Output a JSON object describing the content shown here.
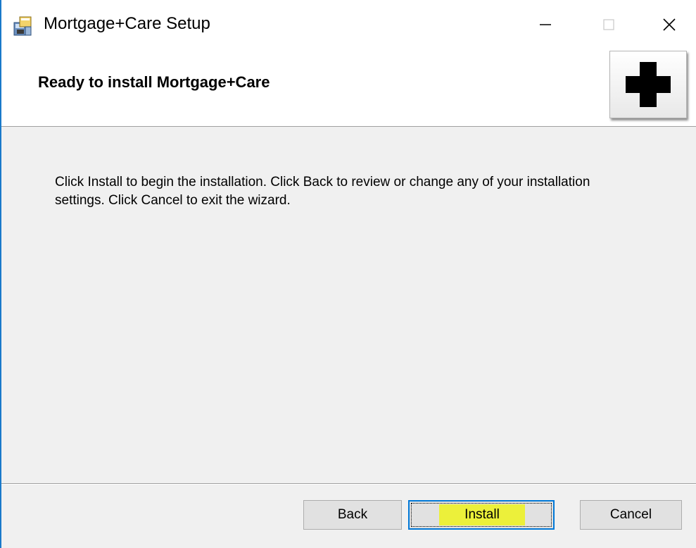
{
  "window": {
    "title": "Mortgage+Care Setup",
    "controls": {
      "minimize_icon": "minimize-icon",
      "maximize_icon": "maximize-icon",
      "close_icon": "close-icon"
    }
  },
  "header": {
    "title": "Ready to install Mortgage+Care",
    "icon": "plus-icon"
  },
  "body": {
    "message": "Click Install to begin the installation. Click Back to review or change any of your installation settings. Click Cancel to exit the wizard."
  },
  "footer": {
    "back_label": "Back",
    "install_label": "Install",
    "cancel_label": "Cancel"
  },
  "colors": {
    "accent": "#0078d7",
    "highlight": "#ecf03a",
    "dialog_bg": "#f0f0f0"
  }
}
